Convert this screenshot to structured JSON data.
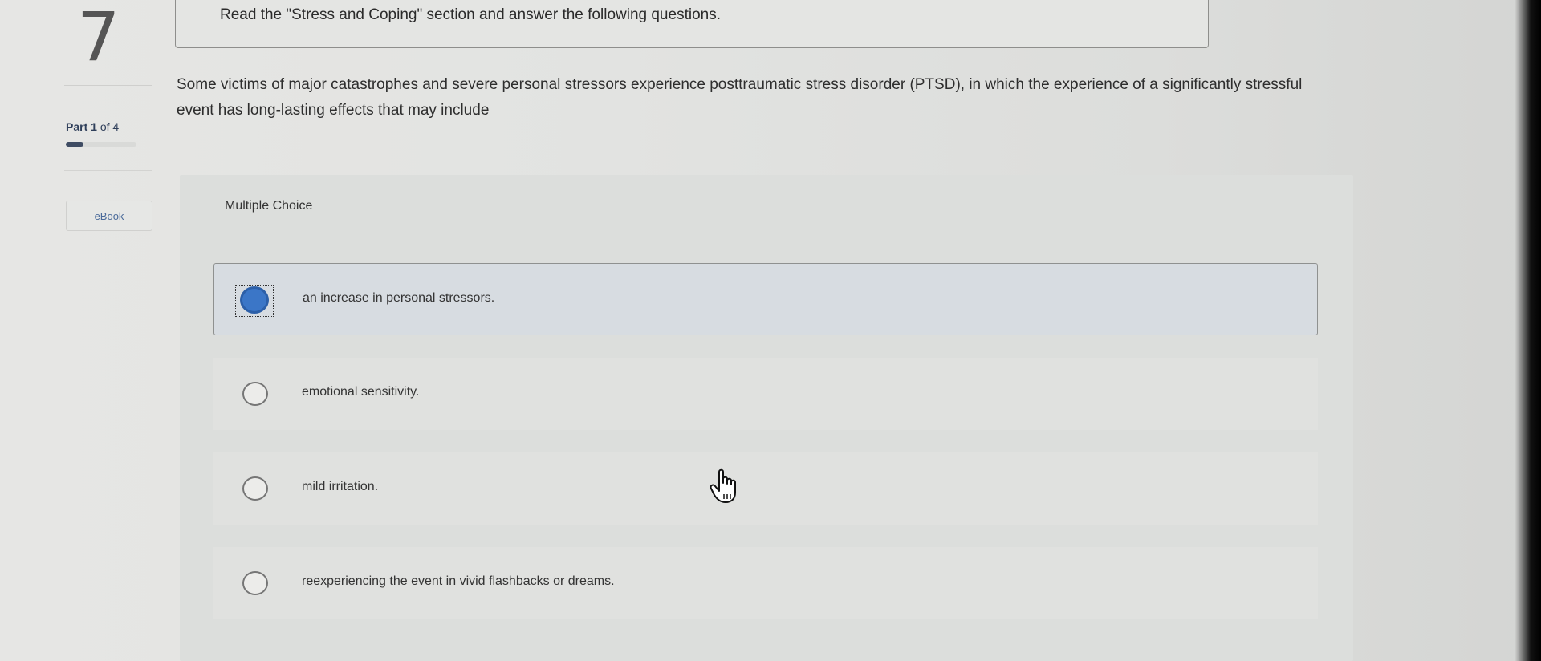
{
  "question": {
    "number": "7",
    "part_label_prefix": "Part",
    "part_current": "1",
    "part_of": "of",
    "part_total": "4",
    "progress": 0.25,
    "ebook_label": "eBook",
    "instruction": "Read the \"Stress and Coping\" section and answer the following questions.",
    "prompt": "Some victims of major catastrophes and severe personal stressors experience posttraumatic stress disorder (PTSD), in which the experience of a significantly stressful event has long-lasting effects that may include"
  },
  "answer_area": {
    "type_label": "Multiple Choice",
    "choices": [
      {
        "label": "an increase in personal stressors.",
        "selected": true
      },
      {
        "label": "emotional sensitivity.",
        "selected": false
      },
      {
        "label": "mild irritation.",
        "selected": false
      },
      {
        "label": "reexperiencing the event in vivid flashbacks or dreams.",
        "selected": false
      }
    ]
  },
  "colors": {
    "selected_radio": "#3b76c7",
    "progress_fill": "#3f4c63",
    "ebook_text": "#4a6a9a"
  },
  "icons": {
    "cursor": "hand-pointer-icon"
  }
}
